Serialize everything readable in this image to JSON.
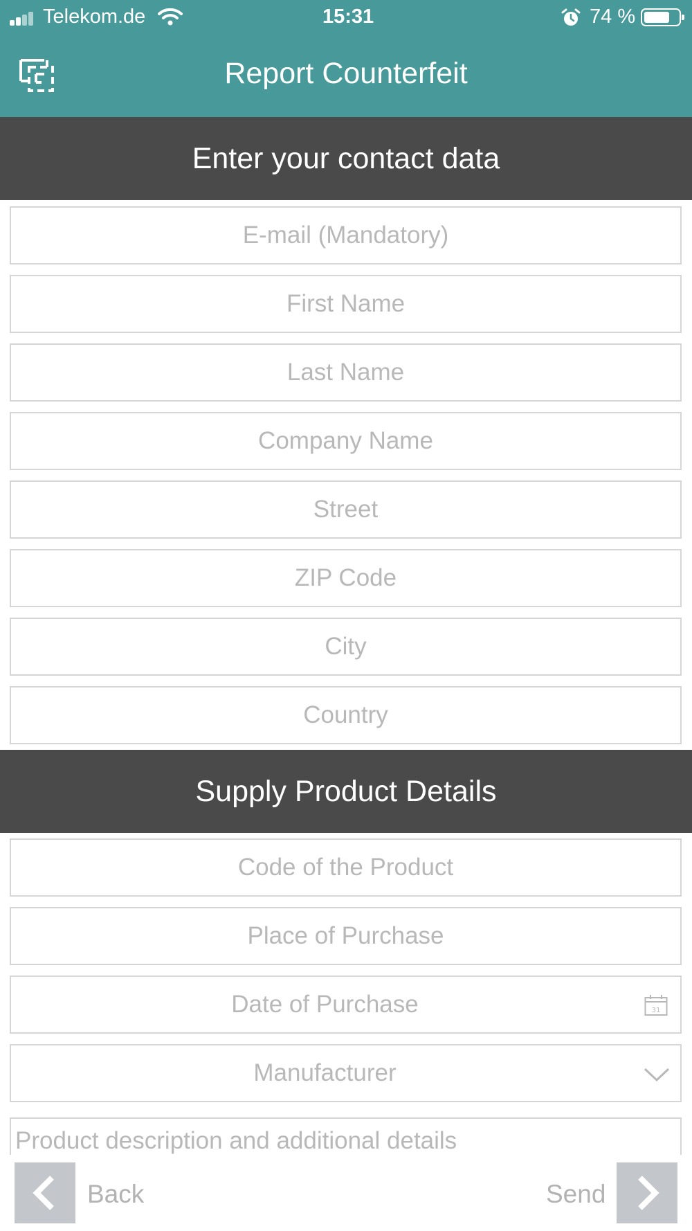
{
  "status_bar": {
    "carrier": "Telekom.de",
    "time": "15:31",
    "battery_percent": "74 %",
    "battery_level": 0.74,
    "icons": [
      "signal-icon",
      "wifi-icon",
      "alarm-icon",
      "battery-icon"
    ]
  },
  "header": {
    "icon": "scan-frame-icon",
    "title": "Report Counterfeit"
  },
  "contact_section": {
    "title": "Enter your contact data",
    "fields": [
      {
        "placeholder": "E-mail (Mandatory)",
        "value": ""
      },
      {
        "placeholder": "First Name",
        "value": ""
      },
      {
        "placeholder": "Last Name",
        "value": ""
      },
      {
        "placeholder": "Company Name",
        "value": ""
      },
      {
        "placeholder": "Street",
        "value": ""
      },
      {
        "placeholder": "ZIP Code",
        "value": ""
      },
      {
        "placeholder": "City",
        "value": ""
      },
      {
        "placeholder": "Country",
        "value": ""
      }
    ]
  },
  "product_section": {
    "title": "Supply Product Details",
    "code_placeholder": "Code of the Product",
    "place_placeholder": "Place of Purchase",
    "date_placeholder": "Date of Purchase",
    "date_icon_text": "31",
    "manufacturer_value": "Manufacturer",
    "description_placeholder": "Product description and additional details"
  },
  "nav": {
    "back_label": "Back",
    "send_label": "Send"
  },
  "colors": {
    "header_teal": "#489a9a",
    "section_dark": "#4a4a4a",
    "placeholder": "#b8b8b8",
    "nav_button": "#c3c7cb"
  }
}
